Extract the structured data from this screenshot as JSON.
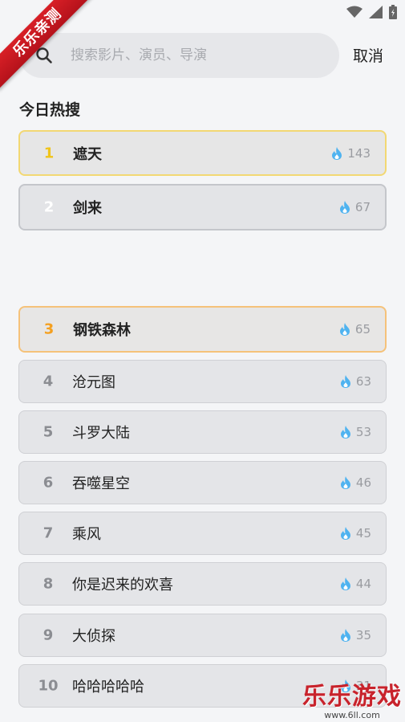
{
  "watermark": {
    "ribbon_text": "乐乐亲测",
    "site_title": "乐乐游戏",
    "site_url": "www.6ll.com"
  },
  "search": {
    "placeholder": "搜索影片、演员、导演",
    "value": "",
    "cancel_label": "取消"
  },
  "section_title": "今日热搜",
  "items": [
    {
      "rank": "1",
      "name": "遮天",
      "heat": "143"
    },
    {
      "rank": "2",
      "name": "剑来",
      "heat": "67"
    },
    {
      "rank": "3",
      "name": "钢铁森林",
      "heat": "65"
    },
    {
      "rank": "4",
      "name": "沧元图",
      "heat": "63"
    },
    {
      "rank": "5",
      "name": "斗罗大陆",
      "heat": "53"
    },
    {
      "rank": "6",
      "name": "吞噬星空",
      "heat": "46"
    },
    {
      "rank": "7",
      "name": "乘风",
      "heat": "45"
    },
    {
      "rank": "8",
      "name": "你是迟来的欢喜",
      "heat": "44"
    },
    {
      "rank": "9",
      "name": "大侦探",
      "heat": "35"
    },
    {
      "rank": "10",
      "name": "哈哈哈哈哈",
      "heat": "31"
    }
  ],
  "colors": {
    "accent_gold": "#f0c419",
    "accent_orange": "#f4a020",
    "fire_blue": "#4fb3f0"
  }
}
